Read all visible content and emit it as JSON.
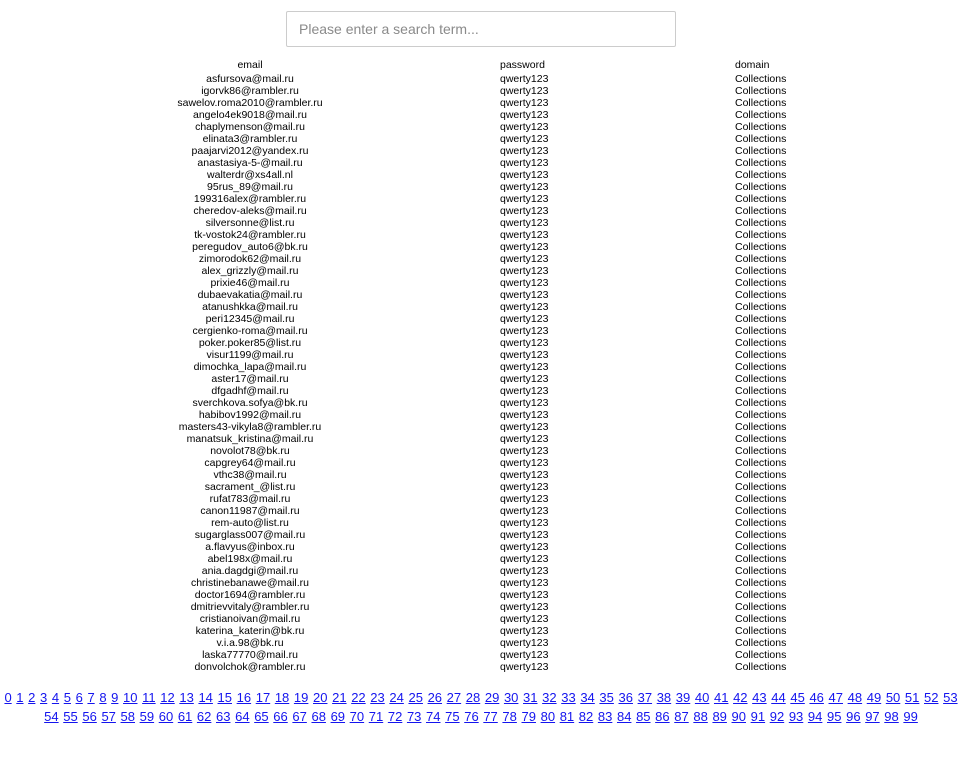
{
  "search": {
    "placeholder": "Please enter a search term...",
    "value": ""
  },
  "table": {
    "columns": [
      "email",
      "password",
      "domain"
    ],
    "rows": [
      [
        "asfursova@mail.ru",
        "qwerty123",
        "Collections"
      ],
      [
        "igorvk86@rambler.ru",
        "qwerty123",
        "Collections"
      ],
      [
        "sawelov.roma2010@rambler.ru",
        "qwerty123",
        "Collections"
      ],
      [
        "angelo4ek9018@mail.ru",
        "qwerty123",
        "Collections"
      ],
      [
        "chaplymenson@mail.ru",
        "qwerty123",
        "Collections"
      ],
      [
        "elinata3@rambler.ru",
        "qwerty123",
        "Collections"
      ],
      [
        "paajarvi2012@yandex.ru",
        "qwerty123",
        "Collections"
      ],
      [
        "anastasiya-5-@mail.ru",
        "qwerty123",
        "Collections"
      ],
      [
        "walterdr@xs4all.nl",
        "qwerty123",
        "Collections"
      ],
      [
        "95rus_89@mail.ru",
        "qwerty123",
        "Collections"
      ],
      [
        "199316alex@rambler.ru",
        "qwerty123",
        "Collections"
      ],
      [
        "cheredov-aleks@mail.ru",
        "qwerty123",
        "Collections"
      ],
      [
        "silversonne@list.ru",
        "qwerty123",
        "Collections"
      ],
      [
        "tk-vostok24@rambler.ru",
        "qwerty123",
        "Collections"
      ],
      [
        "peregudov_auto6@bk.ru",
        "qwerty123",
        "Collections"
      ],
      [
        "zimorodok62@mail.ru",
        "qwerty123",
        "Collections"
      ],
      [
        "alex_grizzly@mail.ru",
        "qwerty123",
        "Collections"
      ],
      [
        "prixie46@mail.ru",
        "qwerty123",
        "Collections"
      ],
      [
        "dubaevakatia@mail.ru",
        "qwerty123",
        "Collections"
      ],
      [
        "atanushkka@mail.ru",
        "qwerty123",
        "Collections"
      ],
      [
        "peri12345@mail.ru",
        "qwerty123",
        "Collections"
      ],
      [
        "cergienko-roma@mail.ru",
        "qwerty123",
        "Collections"
      ],
      [
        "poker.poker85@list.ru",
        "qwerty123",
        "Collections"
      ],
      [
        "visur1199@mail.ru",
        "qwerty123",
        "Collections"
      ],
      [
        "dimochka_lapa@mail.ru",
        "qwerty123",
        "Collections"
      ],
      [
        "aster17@mail.ru",
        "qwerty123",
        "Collections"
      ],
      [
        "dfgadhf@mail.ru",
        "qwerty123",
        "Collections"
      ],
      [
        "sverchkova.sofya@bk.ru",
        "qwerty123",
        "Collections"
      ],
      [
        "habibov1992@mail.ru",
        "qwerty123",
        "Collections"
      ],
      [
        "masters43-vikyla8@rambler.ru",
        "qwerty123",
        "Collections"
      ],
      [
        "manatsuk_kristina@mail.ru",
        "qwerty123",
        "Collections"
      ],
      [
        "novolot78@bk.ru",
        "qwerty123",
        "Collections"
      ],
      [
        "capgrey64@mail.ru",
        "qwerty123",
        "Collections"
      ],
      [
        "vthc38@mail.ru",
        "qwerty123",
        "Collections"
      ],
      [
        "sacrament_@list.ru",
        "qwerty123",
        "Collections"
      ],
      [
        "rufat783@mail.ru",
        "qwerty123",
        "Collections"
      ],
      [
        "canon11987@mail.ru",
        "qwerty123",
        "Collections"
      ],
      [
        "rem-auto@list.ru",
        "qwerty123",
        "Collections"
      ],
      [
        "sugarglass007@mail.ru",
        "qwerty123",
        "Collections"
      ],
      [
        "a.flavyus@inbox.ru",
        "qwerty123",
        "Collections"
      ],
      [
        "abel198x@mail.ru",
        "qwerty123",
        "Collections"
      ],
      [
        "ania.dagdgi@mail.ru",
        "qwerty123",
        "Collections"
      ],
      [
        "christinebanawe@mail.ru",
        "qwerty123",
        "Collections"
      ],
      [
        "doctor1694@rambler.ru",
        "qwerty123",
        "Collections"
      ],
      [
        "dmitrievvitaly@rambler.ru",
        "qwerty123",
        "Collections"
      ],
      [
        "cristianoivan@mail.ru",
        "qwerty123",
        "Collections"
      ],
      [
        "katerina_katerin@bk.ru",
        "qwerty123",
        "Collections"
      ],
      [
        "v.i.a.98@bk.ru",
        "qwerty123",
        "Collections"
      ],
      [
        "laska77770@mail.ru",
        "qwerty123",
        "Collections"
      ],
      [
        "donvolchok@rambler.ru",
        "qwerty123",
        "Collections"
      ]
    ]
  },
  "pagination": {
    "link_color": "#1414ee",
    "pages": [
      "0",
      "1",
      "2",
      "3",
      "4",
      "5",
      "6",
      "7",
      "8",
      "9",
      "10",
      "11",
      "12",
      "13",
      "14",
      "15",
      "16",
      "17",
      "18",
      "19",
      "20",
      "21",
      "22",
      "23",
      "24",
      "25",
      "26",
      "27",
      "28",
      "29",
      "30",
      "31",
      "32",
      "33",
      "34",
      "35",
      "36",
      "37",
      "38",
      "39",
      "40",
      "41",
      "42",
      "43",
      "44",
      "45",
      "46",
      "47",
      "48",
      "49",
      "50",
      "51",
      "52",
      "53",
      "54",
      "55",
      "56",
      "57",
      "58",
      "59",
      "60",
      "61",
      "62",
      "63",
      "64",
      "65",
      "66",
      "67",
      "68",
      "69",
      "70",
      "71",
      "72",
      "73",
      "74",
      "75",
      "76",
      "77",
      "78",
      "79",
      "80",
      "81",
      "82",
      "83",
      "84",
      "85",
      "86",
      "87",
      "88",
      "89",
      "90",
      "91",
      "92",
      "93",
      "94",
      "95",
      "96",
      "97",
      "98",
      "99"
    ]
  }
}
